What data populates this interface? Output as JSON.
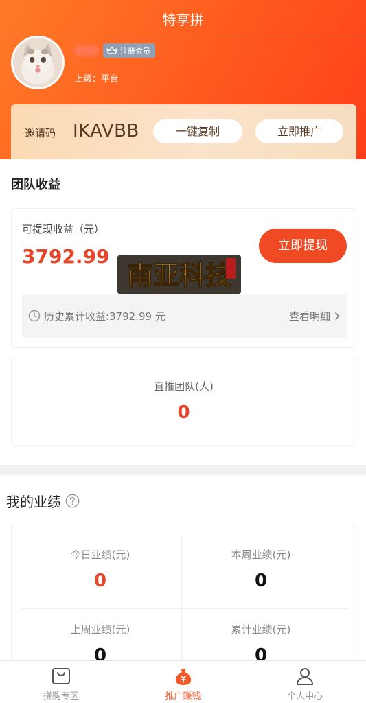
{
  "header": {
    "title": "特享拼",
    "member_badge": "注册会员",
    "superior": "上级：平台"
  },
  "invite": {
    "label": "邀请码",
    "code": "IKAVBB",
    "copy_button": "一键复制",
    "promote_button": "立即推广"
  },
  "team_earnings": {
    "section_title": "团队收益",
    "withdrawable_label": "可提现收益（元）",
    "withdrawable_amount": "3792.99",
    "withdraw_button": "立即提现",
    "history_text": "历史累计收益:3792.99 元",
    "details_link": "查看明细"
  },
  "watermark": {
    "text": "南亚科技"
  },
  "direct_team": {
    "label": "直推团队(人)",
    "value": "0"
  },
  "performance": {
    "section_title": "我的业绩",
    "cells": [
      {
        "label": "今日业绩(元)",
        "value": "0"
      },
      {
        "label": "本周业绩(元)",
        "value": "0"
      },
      {
        "label": "上周业绩(元)",
        "value": "0"
      },
      {
        "label": "累计业绩(元)",
        "value": "0"
      }
    ]
  },
  "tabbar": {
    "items": [
      {
        "label": "拼购专区",
        "icon": "shopping-bag-icon",
        "active": false
      },
      {
        "label": "推广赚钱",
        "icon": "money-bag-icon",
        "active": true
      },
      {
        "label": "个人中心",
        "icon": "user-icon",
        "active": false
      }
    ]
  },
  "colors": {
    "brand_orange": "#ff5a1e",
    "accent_red": "#e8442a",
    "button_red": "#f04a24",
    "invite_gold_bg": "#fbd9b4",
    "member_badge_bg": "#8f9fb4",
    "active_tab": "#f05a2a",
    "inactive_tab": "#999999"
  }
}
